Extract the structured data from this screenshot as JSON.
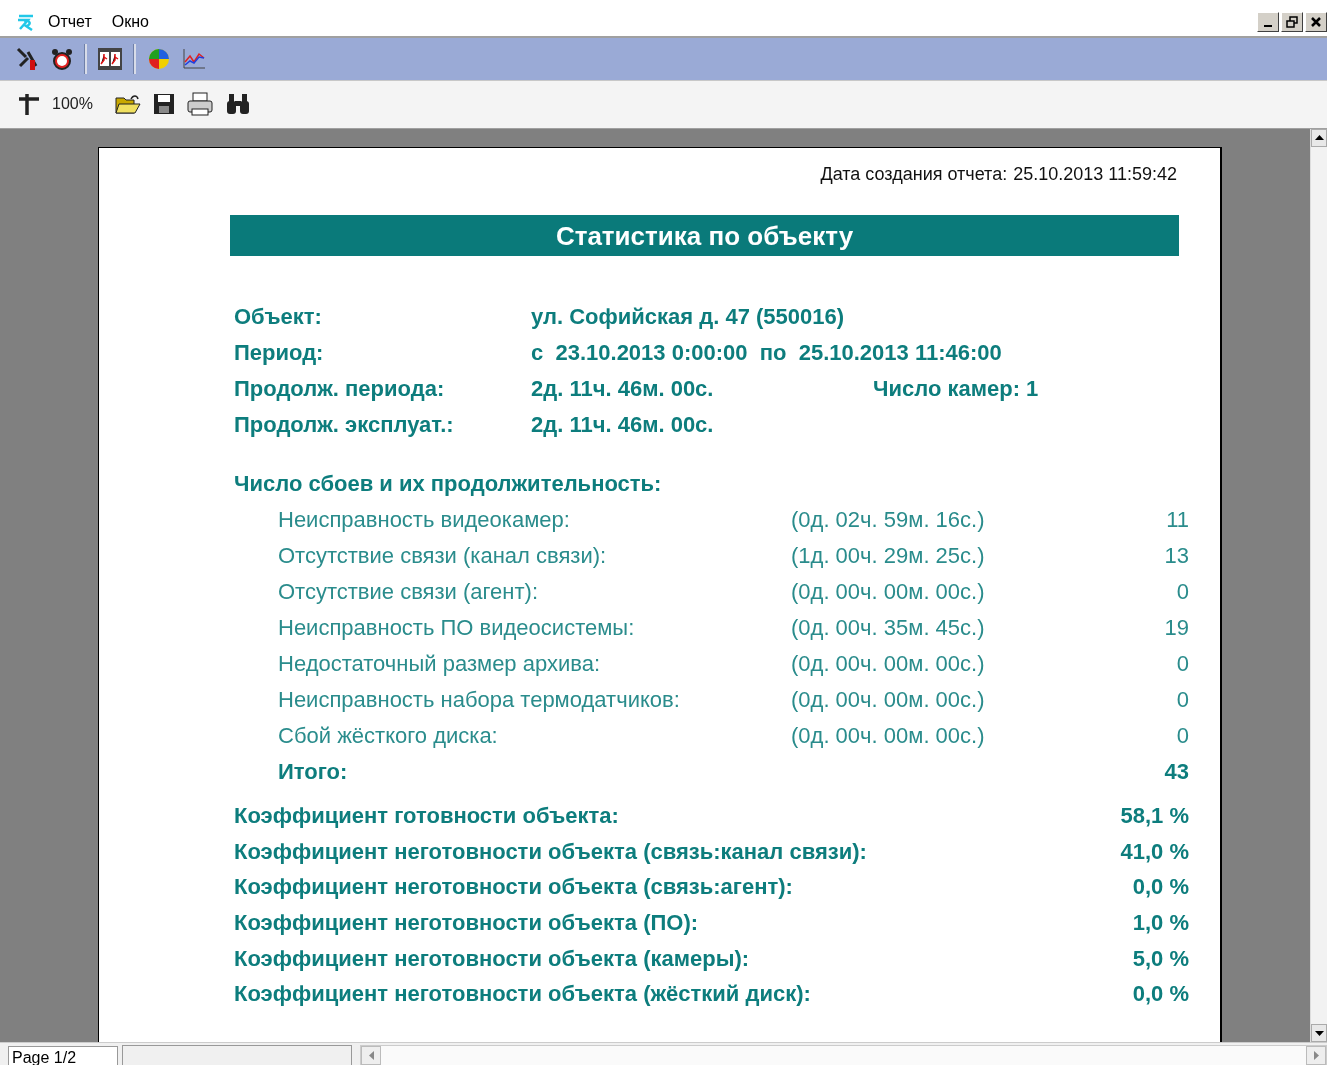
{
  "menu": [
    {
      "label": "Отчет"
    },
    {
      "label": "Окно"
    }
  ],
  "toolbar": {
    "zoom": "100%"
  },
  "report": {
    "created_label": "Дата создания отчета:",
    "created": "25.10.2013 11:59:42",
    "title": "Статистика по объекту",
    "info": [
      {
        "label": "Объект:",
        "value": "ул. Софийская д. 47 (550016)"
      },
      {
        "label": "Период:",
        "value": "с  23.10.2013 0:00:00  по  25.10.2013 11:46:00"
      },
      {
        "label": "Продолж. периода:",
        "value": "2д. 11ч. 46м. 00с.",
        "extra": "Число камер: 1"
      },
      {
        "label": "Продолж. эксплуат.:",
        "value": "2д. 11ч. 46м. 00с."
      }
    ],
    "failures": {
      "heading": "Число сбоев и их продолжительность:",
      "items": [
        {
          "label": "Неисправность видеокамер:",
          "duration": "(0д. 02ч. 59м. 16с.)",
          "count": "11"
        },
        {
          "label": "Отсутствие связи (канал связи):",
          "duration": "(1д. 00ч. 29м. 25с.)",
          "count": "13"
        },
        {
          "label": "Отсутствие связи (агент):",
          "duration": "(0д. 00ч. 00м. 00с.)",
          "count": "0"
        },
        {
          "label": "Неисправность ПО видеосистемы:",
          "duration": "(0д. 00ч. 35м. 45с.)",
          "count": "19"
        },
        {
          "label": "Недостаточный размер архива:",
          "duration": "(0д. 00ч. 00м. 00с.)",
          "count": "0"
        },
        {
          "label": "Неисправность набора термодатчиков:",
          "duration": "(0д. 00ч. 00м. 00с.)",
          "count": "0"
        },
        {
          "label": "Сбой жёсткого диска:",
          "duration": "(0д. 00ч. 00м. 00с.)",
          "count": "0"
        }
      ],
      "total": {
        "label": "Итого:",
        "count": "43"
      }
    },
    "coefficients": [
      {
        "label": "Коэффициент готовности объекта:",
        "value": "58,1 %"
      },
      {
        "label": "Коэффициент неготовности объекта (связь:канал связи):",
        "value": "41,0 %"
      },
      {
        "label": "Коэффициент неготовности объекта (связь:агент):",
        "value": "0,0 %"
      },
      {
        "label": "Коэффициент неготовности объекта (ПО):",
        "value": "1,0 %"
      },
      {
        "label": "Коэффициент неготовности объекта (камеры):",
        "value": "5,0 %"
      },
      {
        "label": "Коэффициент неготовности объекта (жёсткий диск):",
        "value": "0,0 %"
      }
    ]
  },
  "status_bar": {
    "page": "Page 1/2"
  }
}
